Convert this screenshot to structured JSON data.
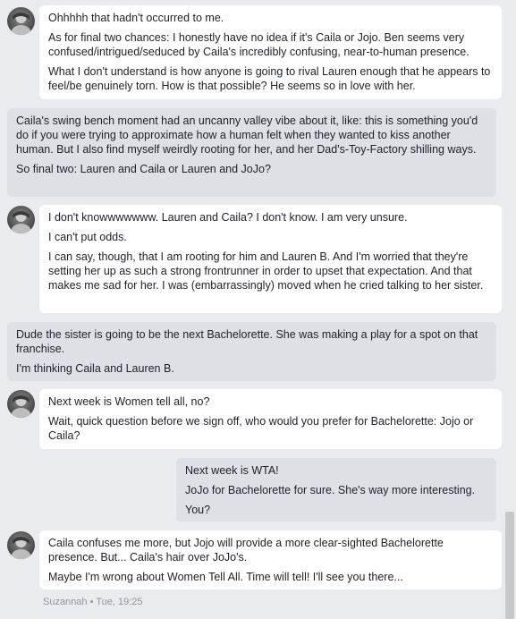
{
  "messages": [
    {
      "paragraphs": [
        "Ohhhhh that hadn't occurred to me.",
        "As for final two chances: I honestly have no idea if it's Caila or Jojo. Ben seems very confused/intrigued/seduced by Caila's incredibly confusing, near-to-human presence.",
        "What I don't understand is how anyone is going to rival Lauren enough that he appears to feel/be genuinely torn. How is that possible? He seems so in love with her."
      ]
    },
    {
      "paragraphs": [
        "Caila's  swing bench moment had an uncanny valley vibe about it, like: this is something you'd do if you were trying to approximate how a human felt when they wanted to kiss another human. But I also find myself weirdly rooting for her, and her Dad's-Toy-Factory shilling ways.",
        "So final two: Lauren and Caila or Lauren and JoJo?"
      ]
    },
    {
      "paragraphs": [
        "I don't knowwwwwww. Lauren and Caila? I don't know. I am very unsure.",
        "I can't put odds.",
        "I can say, though, that I am rooting for him and Lauren B. And I'm worried that they're setting her up as such a strong frontrunner in order to upset that expectation. And that makes me sad for her. I was (embarrassingly) moved when he cried talking to her sister."
      ]
    },
    {
      "paragraphs": [
        "Dude the sister is going to be the next Bachelorette. She was making a play for a spot on that franchise.",
        "I'm thinking Caila and Lauren B."
      ]
    },
    {
      "paragraphs": [
        "Next week is Women tell all, no?",
        "Wait, quick question before we sign off, who would you prefer for Bachelorette: Jojo or Caila?"
      ]
    },
    {
      "paragraphs": [
        "Next week is WTA!",
        "JoJo for Bachelorette for sure. She's way more interesting.",
        "You?"
      ]
    },
    {
      "paragraphs": [
        "Caila confuses me more, but Jojo will provide a more clear-sighted Bachelorette presence. But... Caila's hair over JoJo's.",
        "Maybe I'm wrong about Women Tell All. Time will tell! I'll see you there..."
      ]
    }
  ],
  "last_seen": "Suzannah • Tue, 19:25",
  "colors": {
    "background": "#e9ebee",
    "incoming_bubble": "#ffffff",
    "outgoing_bubble": "#dde0e4",
    "text": "#1d2129",
    "meta_text": "#90949c"
  }
}
